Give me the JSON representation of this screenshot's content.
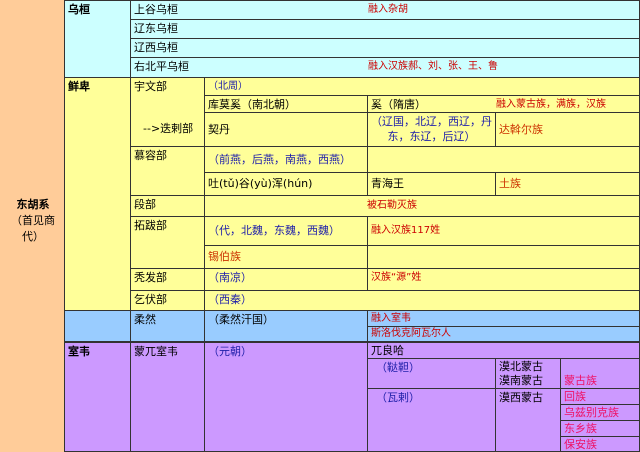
{
  "left": {
    "title": "东胡系",
    "note1": "（首见商",
    "note2": "代）"
  },
  "wuhuan": {
    "name": "乌桓",
    "rows": [
      "上谷乌桓",
      "辽东乌桓",
      "辽西乌桓",
      "右北平乌桓"
    ],
    "fate1": "融入杂胡",
    "fate4": "融入汉族郝、刘、张、王、鲁"
  },
  "xianbei": {
    "name": "鲜卑",
    "yuwen": {
      "name": "宇文部",
      "dyn": "（北周）",
      "kumoxi": "库莫奚（南北朝）",
      "xi": "奚（隋唐）",
      "xi_fate": "融入蒙古族，满族，汉族"
    },
    "diela": {
      "name": "-->迭剌部",
      "qidan": "契丹",
      "dyn": "（辽国，北辽，西辽，丹东，东辽，后辽）",
      "fate": "达斡尔族"
    },
    "murong": {
      "name": "慕容部",
      "dyn": "（前燕，后燕，南燕，西燕）",
      "tuyuhun": "吐(tǔ)谷(yù)浑(hún)",
      "qinghai": "青海王",
      "fate": "土族"
    },
    "duan": {
      "name": "段部",
      "fate": "被石勒灭族"
    },
    "tuoba": {
      "name": "拓跋部",
      "dyn": "（代，北魏，东魏，西魏）",
      "fate": "融入汉族117姓",
      "xibo": "锡伯族"
    },
    "tufa": {
      "name": "秃发部",
      "dyn": "（南凉）",
      "fate": "汉族“源”姓"
    },
    "qifu": {
      "name": "乞伏部",
      "dyn": "（西秦）"
    }
  },
  "rouran": {
    "name": "柔然",
    "dyn": "（柔然汗国）",
    "fate1": "融入室韦",
    "fate2": "斯洛伐克阿瓦尔人"
  },
  "shiwei": {
    "name": "室韦",
    "sub": "蒙兀室韦",
    "dyn": "（元朝）",
    "wuliangha": "兀良哈",
    "dada": "（鞑靼）",
    "wala": "（瓦剌）",
    "mobei": "漠北蒙古",
    "monan": "漠南蒙古",
    "moxi": "漠西蒙古",
    "peoples": [
      "蒙古族",
      "回族",
      "乌兹别克族",
      "东乡族",
      "保安族"
    ]
  }
}
